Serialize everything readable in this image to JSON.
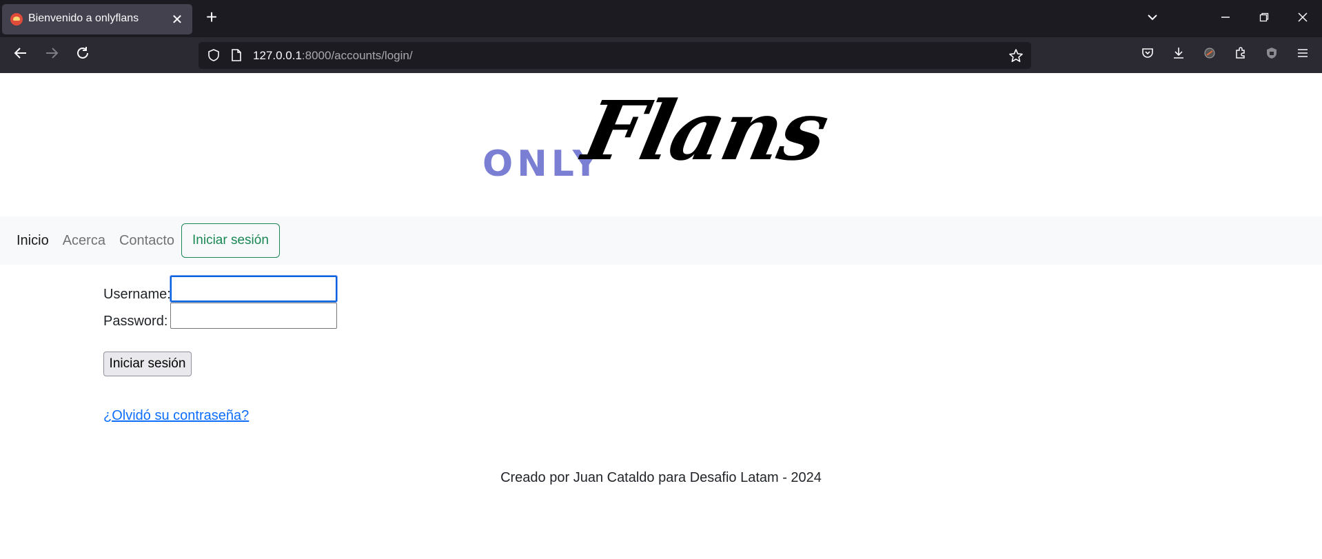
{
  "browser": {
    "tab_title": "Bienvenido a onlyflans",
    "tab_close": "✕",
    "new_tab": "+",
    "url_host": "127.0.0.1",
    "url_rest": ":8000/accounts/login/",
    "icons": {
      "tab_list": "chevron-down-icon",
      "minimize": "minimize-icon",
      "restore": "restore-icon",
      "close_window": "close-icon",
      "back": "back-arrow-icon",
      "forward": "forward-arrow-icon",
      "reload": "reload-icon",
      "shield": "shield-icon",
      "page": "page-icon",
      "bookmark": "star-icon",
      "pocket": "pocket-icon",
      "downloads": "download-icon",
      "extension_1": "extension-icon",
      "extensions": "puzzle-icon",
      "ublock": "ublock-icon",
      "menu": "hamburger-menu-icon"
    }
  },
  "logo": {
    "only": "ONLY",
    "flans": "Flans"
  },
  "nav": {
    "items": [
      {
        "label": "Inicio",
        "active": true
      },
      {
        "label": "Acerca",
        "active": false
      },
      {
        "label": "Contacto",
        "active": false
      }
    ],
    "login_button": "Iniciar sesión",
    "login_color": "#198754"
  },
  "form": {
    "username_label": "Username:",
    "username_value": "",
    "password_label": "Password:",
    "password_value": "",
    "submit_label": "Iniciar sesión",
    "forgot_link": "¿Olvidó su contraseña?"
  },
  "footer": {
    "text": "Creado por Juan Cataldo para Desafio Latam - 2024"
  },
  "colors": {
    "logo_accent": "#7b7fd4",
    "link": "#0d6efd"
  }
}
